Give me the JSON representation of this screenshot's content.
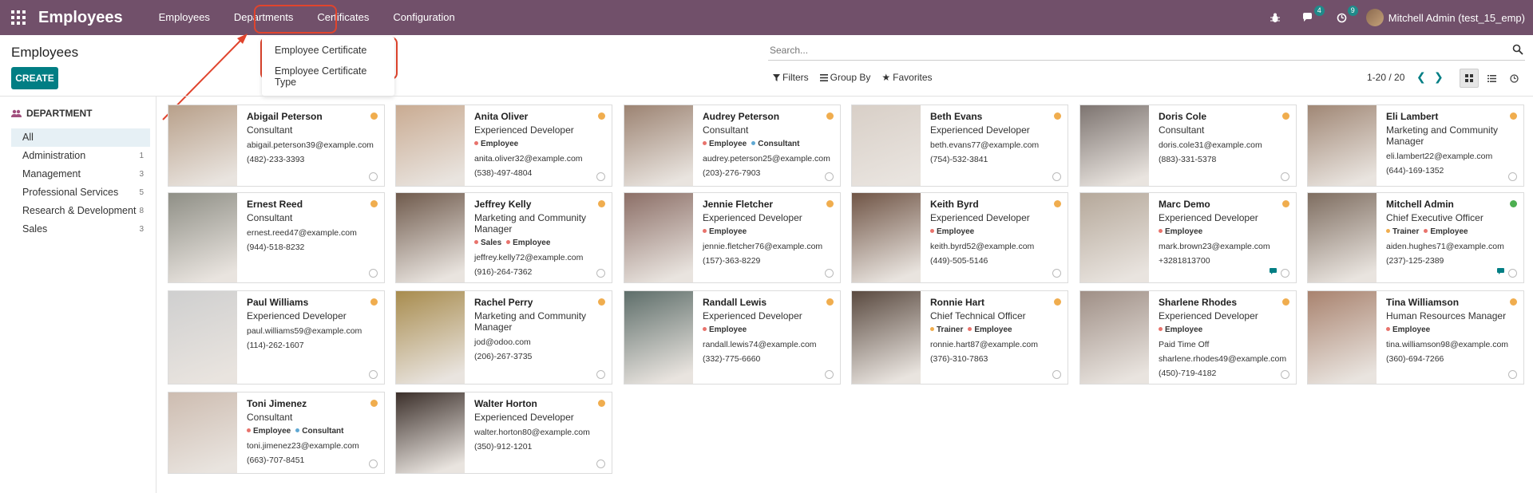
{
  "navbar": {
    "app_title": "Employees",
    "menu": [
      "Employees",
      "Departments",
      "Certificates",
      "Configuration"
    ],
    "chat_badge": "4",
    "activity_badge": "9",
    "user": "Mitchell Admin (test_15_emp)"
  },
  "dropdown": {
    "items": [
      "Employee Certificate",
      "Employee Certificate Type"
    ]
  },
  "control": {
    "title": "Employees",
    "create": "CREATE",
    "search_placeholder": "Search...",
    "filters": "Filters",
    "group_by": "Group By",
    "favorites": "Favorites",
    "pager": "1-20 / 20"
  },
  "sidebar": {
    "header": "DEPARTMENT",
    "items": [
      {
        "label": "All",
        "count": ""
      },
      {
        "label": "Administration",
        "count": "1"
      },
      {
        "label": "Management",
        "count": "3"
      },
      {
        "label": "Professional Services",
        "count": "5"
      },
      {
        "label": "Research & Development",
        "count": "8"
      },
      {
        "label": "Sales",
        "count": "3"
      }
    ]
  },
  "colors": {
    "navbar": "#71506a",
    "accent": "#017e84",
    "status_away": "#f0ad4e",
    "status_online": "#4caf50"
  },
  "employees": [
    {
      "name": "Abigail Peterson",
      "job": "Consultant",
      "tags": [],
      "lines": [
        "abigail.peterson39@example.com",
        "(482)-233-3393"
      ],
      "status": "#f0ad4e"
    },
    {
      "name": "Anita Oliver",
      "job": "Experienced Developer",
      "tags": [
        {
          "t": "Employee",
          "c": "#e8736c"
        }
      ],
      "lines": [
        "anita.oliver32@example.com",
        "(538)-497-4804"
      ],
      "status": "#f0ad4e"
    },
    {
      "name": "Audrey Peterson",
      "job": "Consultant",
      "tags": [
        {
          "t": "Employee",
          "c": "#e8736c"
        },
        {
          "t": "Consultant",
          "c": "#5fa8d3"
        }
      ],
      "lines": [
        "audrey.peterson25@example.com",
        "(203)-276-7903"
      ],
      "status": "#f0ad4e"
    },
    {
      "name": "Beth Evans",
      "job": "Experienced Developer",
      "tags": [],
      "lines": [
        "beth.evans77@example.com",
        "(754)-532-3841"
      ],
      "status": "#f0ad4e"
    },
    {
      "name": "Doris Cole",
      "job": "Consultant",
      "tags": [],
      "lines": [
        "doris.cole31@example.com",
        "(883)-331-5378"
      ],
      "status": "#f0ad4e"
    },
    {
      "name": "Eli Lambert",
      "job": "Marketing and Community Manager",
      "tags": [],
      "lines": [
        "eli.lambert22@example.com",
        "(644)-169-1352"
      ],
      "status": "#f0ad4e"
    },
    {
      "name": "Ernest Reed",
      "job": "Consultant",
      "tags": [],
      "lines": [
        "ernest.reed47@example.com",
        "(944)-518-8232"
      ],
      "status": "#f0ad4e"
    },
    {
      "name": "Jeffrey Kelly",
      "job": "Marketing and Community Manager",
      "tags": [
        {
          "t": "Sales",
          "c": "#e8736c"
        },
        {
          "t": "Employee",
          "c": "#e8736c"
        }
      ],
      "lines": [
        "jeffrey.kelly72@example.com",
        "(916)-264-7362"
      ],
      "status": "#f0ad4e"
    },
    {
      "name": "Jennie Fletcher",
      "job": "Experienced Developer",
      "tags": [
        {
          "t": "Employee",
          "c": "#e8736c"
        }
      ],
      "lines": [
        "jennie.fletcher76@example.com",
        "(157)-363-8229"
      ],
      "status": "#f0ad4e"
    },
    {
      "name": "Keith Byrd",
      "job": "Experienced Developer",
      "tags": [
        {
          "t": "Employee",
          "c": "#e8736c"
        }
      ],
      "lines": [
        "keith.byrd52@example.com",
        "(449)-505-5146"
      ],
      "status": "#f0ad4e"
    },
    {
      "name": "Marc Demo",
      "job": "Experienced Developer",
      "tags": [
        {
          "t": "Employee",
          "c": "#e8736c"
        }
      ],
      "lines": [
        "mark.brown23@example.com",
        "+3281813700"
      ],
      "status": "#f0ad4e"
    },
    {
      "name": "Mitchell Admin",
      "job": "Chief Executive Officer",
      "tags": [
        {
          "t": "Trainer",
          "c": "#f0ad4e"
        },
        {
          "t": "Employee",
          "c": "#e8736c"
        }
      ],
      "lines": [
        "aiden.hughes71@example.com",
        "(237)-125-2389"
      ],
      "status": "#4caf50"
    },
    {
      "name": "Paul Williams",
      "job": "Experienced Developer",
      "tags": [],
      "lines": [
        "paul.williams59@example.com",
        "(114)-262-1607"
      ],
      "status": "#f0ad4e"
    },
    {
      "name": "Rachel Perry",
      "job": "Marketing and Community Manager",
      "tags": [],
      "lines": [
        "jod@odoo.com",
        "(206)-267-3735"
      ],
      "status": "#f0ad4e"
    },
    {
      "name": "Randall Lewis",
      "job": "Experienced Developer",
      "tags": [
        {
          "t": "Employee",
          "c": "#e8736c"
        }
      ],
      "lines": [
        "randall.lewis74@example.com",
        "(332)-775-6660"
      ],
      "status": "#f0ad4e"
    },
    {
      "name": "Ronnie Hart",
      "job": "Chief Technical Officer",
      "tags": [
        {
          "t": "Trainer",
          "c": "#f0ad4e"
        },
        {
          "t": "Employee",
          "c": "#e8736c"
        }
      ],
      "lines": [
        "ronnie.hart87@example.com",
        "(376)-310-7863"
      ],
      "status": "#f0ad4e"
    },
    {
      "name": "Sharlene Rhodes",
      "job": "Experienced Developer",
      "tags": [
        {
          "t": "Employee",
          "c": "#e8736c"
        }
      ],
      "lines": [
        "Paid Time Off",
        "sharlene.rhodes49@example.com",
        "(450)-719-4182"
      ],
      "status": "#f0ad4e"
    },
    {
      "name": "Tina Williamson",
      "job": "Human Resources Manager",
      "tags": [
        {
          "t": "Employee",
          "c": "#e8736c"
        }
      ],
      "lines": [
        "tina.williamson98@example.com",
        "(360)-694-7266"
      ],
      "status": "#f0ad4e"
    },
    {
      "name": "Toni Jimenez",
      "job": "Consultant",
      "tags": [
        {
          "t": "Employee",
          "c": "#e8736c"
        },
        {
          "t": "Consultant",
          "c": "#5fa8d3"
        }
      ],
      "lines": [
        "toni.jimenez23@example.com",
        "(663)-707-8451"
      ],
      "status": "#f0ad4e"
    },
    {
      "name": "Walter Horton",
      "job": "Experienced Developer",
      "tags": [],
      "lines": [
        "walter.horton80@example.com",
        "(350)-912-1201"
      ],
      "status": "#f0ad4e"
    }
  ]
}
